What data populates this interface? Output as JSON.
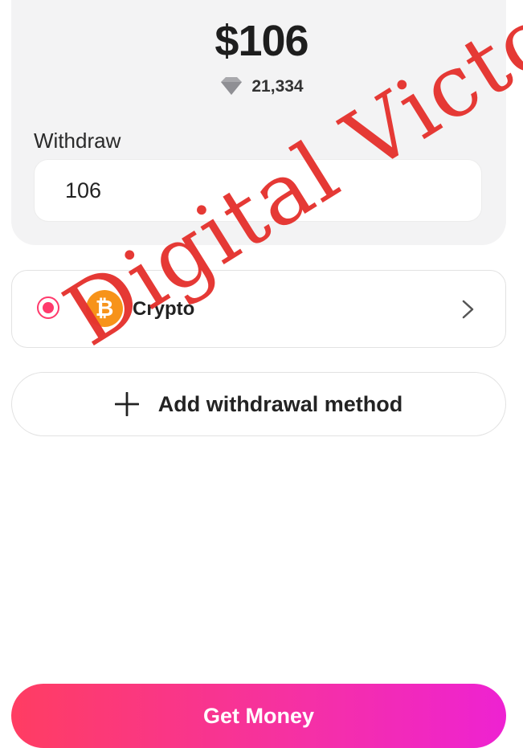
{
  "balance": {
    "amount": "$106",
    "diamond_count": "21,334",
    "diamond_icon": "diamond-icon"
  },
  "withdraw": {
    "label": "Withdraw",
    "value": "106"
  },
  "methods": [
    {
      "name": "Crypto",
      "icon": "bitcoin-icon",
      "selected": true
    }
  ],
  "add_method": {
    "label": "Add withdrawal method",
    "icon": "plus-icon"
  },
  "watermark": "Digital Victoria",
  "cta": {
    "label": "Get Money"
  },
  "colors": {
    "accent": "#ff3a6c",
    "gradient_start": "#ff3d62",
    "gradient_end": "#ee22d2",
    "bitcoin": "#f7931a",
    "watermark": "#e5332f"
  }
}
